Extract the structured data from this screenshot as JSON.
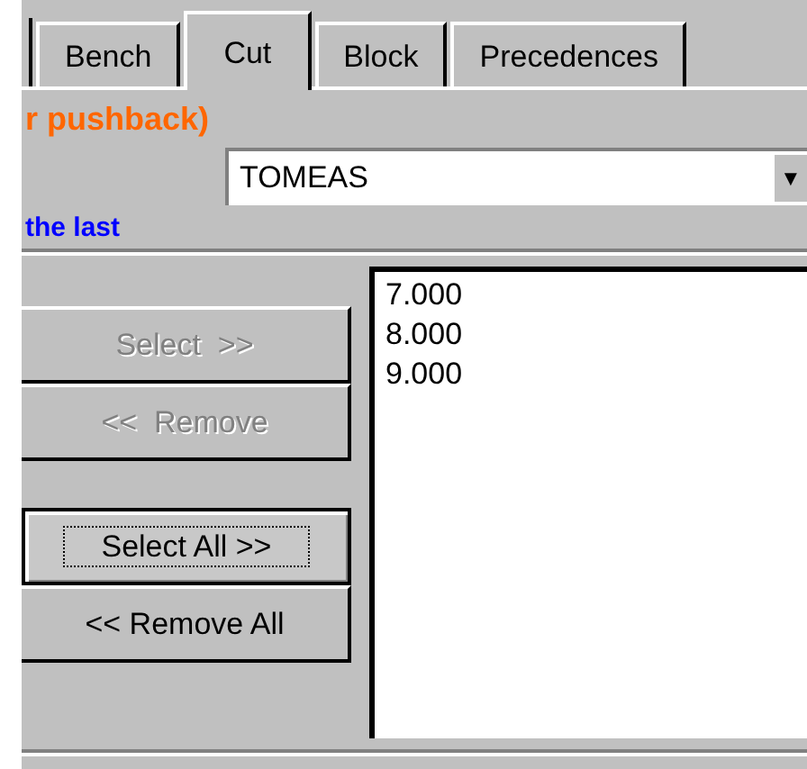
{
  "tabs": [
    {
      "label": "Bench",
      "selected": false
    },
    {
      "label": "Cut",
      "selected": true
    },
    {
      "label": "Block",
      "selected": false
    },
    {
      "label": "Precedences",
      "selected": false
    }
  ],
  "warning_text": "r pushback)",
  "dropdown": {
    "value": "TOMEAS",
    "arrow": "▼"
  },
  "note_text": "the last",
  "buttons": [
    {
      "label": "Select  >>",
      "disabled": true,
      "focused": false
    },
    {
      "label": "<<  Remove",
      "disabled": true,
      "focused": false
    },
    {
      "label": "Select All >>",
      "disabled": false,
      "focused": true
    },
    {
      "label": "<< Remove All",
      "disabled": false,
      "focused": false
    }
  ],
  "list_items": [
    "7.000",
    "8.000",
    "9.000"
  ]
}
